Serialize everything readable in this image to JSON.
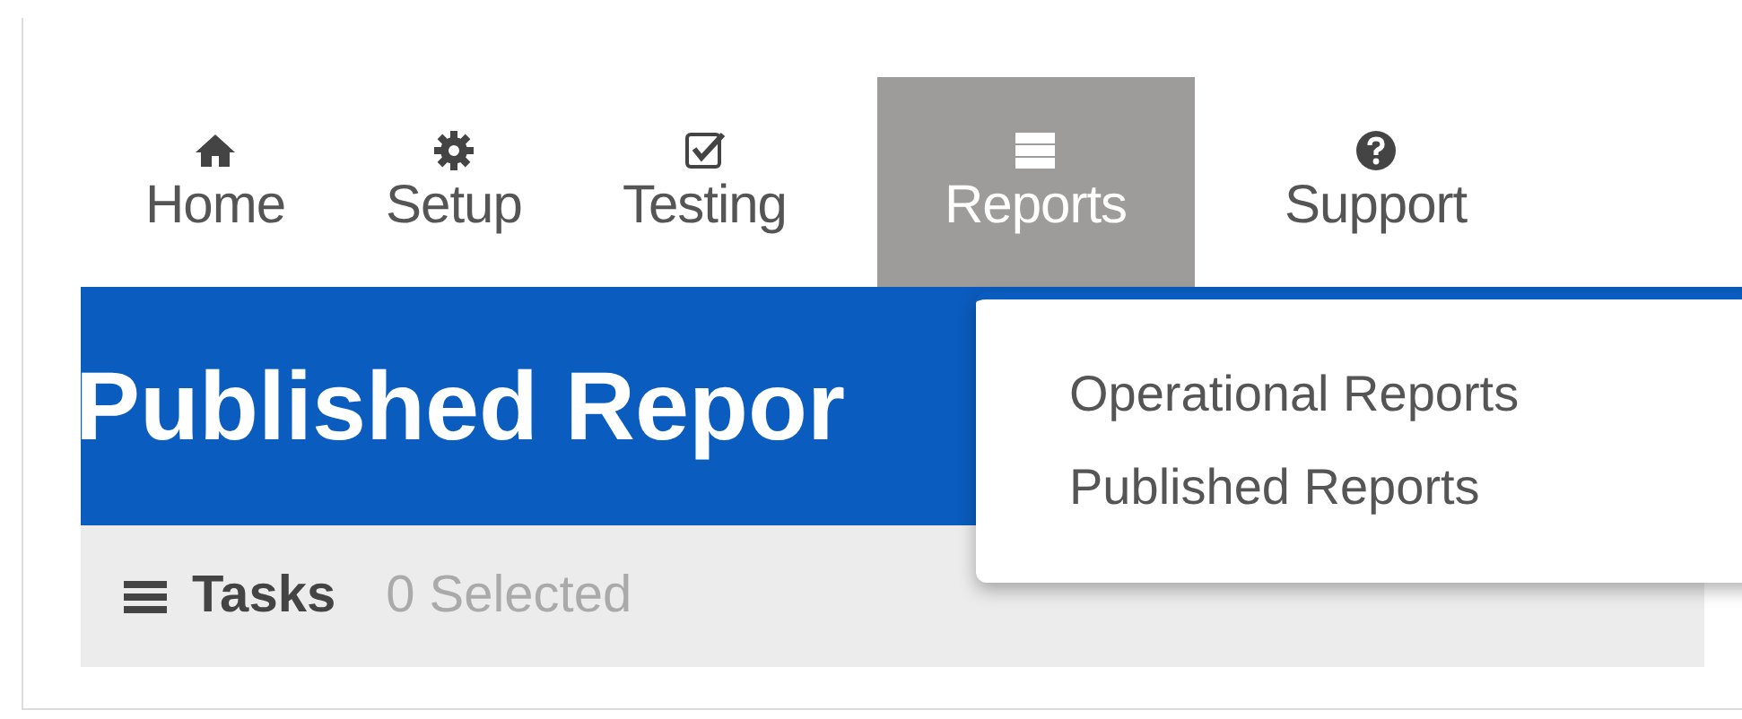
{
  "tabs": [
    {
      "label": "Home",
      "kind": "home",
      "selected": false
    },
    {
      "label": "Setup",
      "kind": "gear",
      "selected": false
    },
    {
      "label": "Testing",
      "kind": "check",
      "selected": false
    },
    {
      "label": "Reports",
      "kind": "server",
      "selected": true
    },
    {
      "label": "Support",
      "kind": "help",
      "selected": false
    }
  ],
  "heading": "Published Repor",
  "dropdown": {
    "items": [
      "Operational Reports",
      "Published Reports"
    ]
  },
  "tasks_bar": {
    "label": "Tasks",
    "selection": "0 Selected"
  }
}
